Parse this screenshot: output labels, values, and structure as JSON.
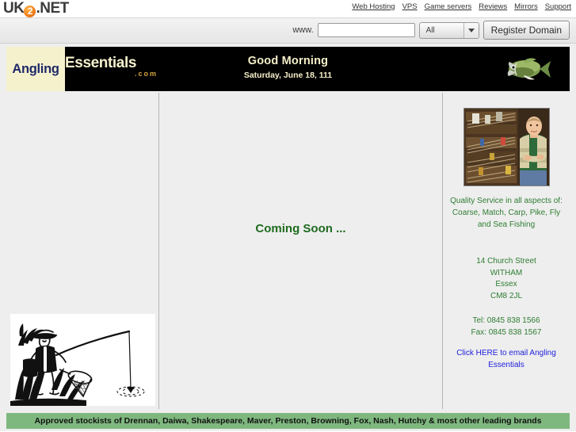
{
  "browser_chrome": {
    "logo": {
      "prefix": "UK",
      "globe_char": "2",
      "suffix": ".NET"
    },
    "nav_links": [
      {
        "label": "Web Hosting"
      },
      {
        "label": "VPS"
      },
      {
        "label": "Game servers"
      },
      {
        "label": "Reviews"
      },
      {
        "label": "Mirrors"
      },
      {
        "label": "Support"
      }
    ],
    "domain_search": {
      "www_label": "www.",
      "input_value": "",
      "input_placeholder": "",
      "tld_selected": "All",
      "register_label": "Register Domain"
    }
  },
  "site": {
    "header": {
      "brand_part1": "Angling",
      "brand_part2": "Essentials",
      "brand_dotcom": ".com",
      "greeting": "Good Morning",
      "date": "Saturday, June 18, 111",
      "fish_icon_name": "fish-image"
    },
    "left_column": {
      "illustration_name": "fisherman-illustration"
    },
    "center_column": {
      "coming_soon": "Coming Soon ..."
    },
    "right_column": {
      "photo_name": "tackle-shop-photo",
      "quality_text": "Quality Service in all aspects of: Coarse, Match, Carp, Pike, Fly and Sea Fishing",
      "address_lines": [
        "14 Church Street",
        "WITHAM",
        "Essex",
        "CM8 2JL"
      ],
      "tel": "Tel: 0845 838 1566",
      "fax": "Fax: 0845 838 1567",
      "email_link": "Click HERE to email Angling Essentials"
    },
    "footer": {
      "stockists": "Approved stockists of Drennan, Daiwa, Shakespeare, Maver, Preston, Browning, Fox, Nash, Hutchy & most other leading brands"
    }
  },
  "colors": {
    "brand_cream": "#f6f1cd",
    "brand_navy": "#1f2a68",
    "brand_orange": "#d9a441",
    "banner_black": "#000000",
    "text_green": "#2e7d32",
    "link_blue": "#2020dd",
    "strip_green": "#7fb87f",
    "uk2_orange": "#f07c1a",
    "page_grey": "#eeeeee"
  }
}
